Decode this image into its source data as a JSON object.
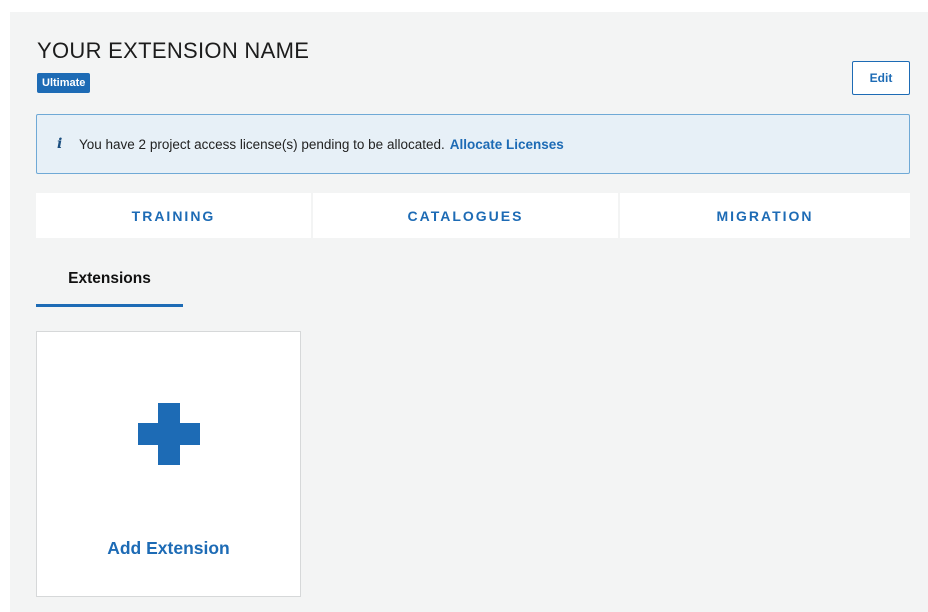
{
  "header": {
    "title": "YOUR EXTENSION NAME",
    "badge": "Ultimate",
    "edit_label": "Edit"
  },
  "info_banner": {
    "icon": "info-icon",
    "message": "You have 2 project access license(s) pending to be allocated.",
    "link_label": "Allocate Licenses"
  },
  "tabs": [
    {
      "label": "TRAINING"
    },
    {
      "label": "CATALOGUES"
    },
    {
      "label": "MIGRATION"
    }
  ],
  "section_tab": {
    "label": "Extensions",
    "active": true
  },
  "add_card": {
    "icon": "plus-icon",
    "label": "Add Extension"
  },
  "colors": {
    "accent": "#1d6bb5",
    "background": "#f3f4f4",
    "banner_bg": "#e7f0f7",
    "banner_border": "#6fa9d6"
  }
}
